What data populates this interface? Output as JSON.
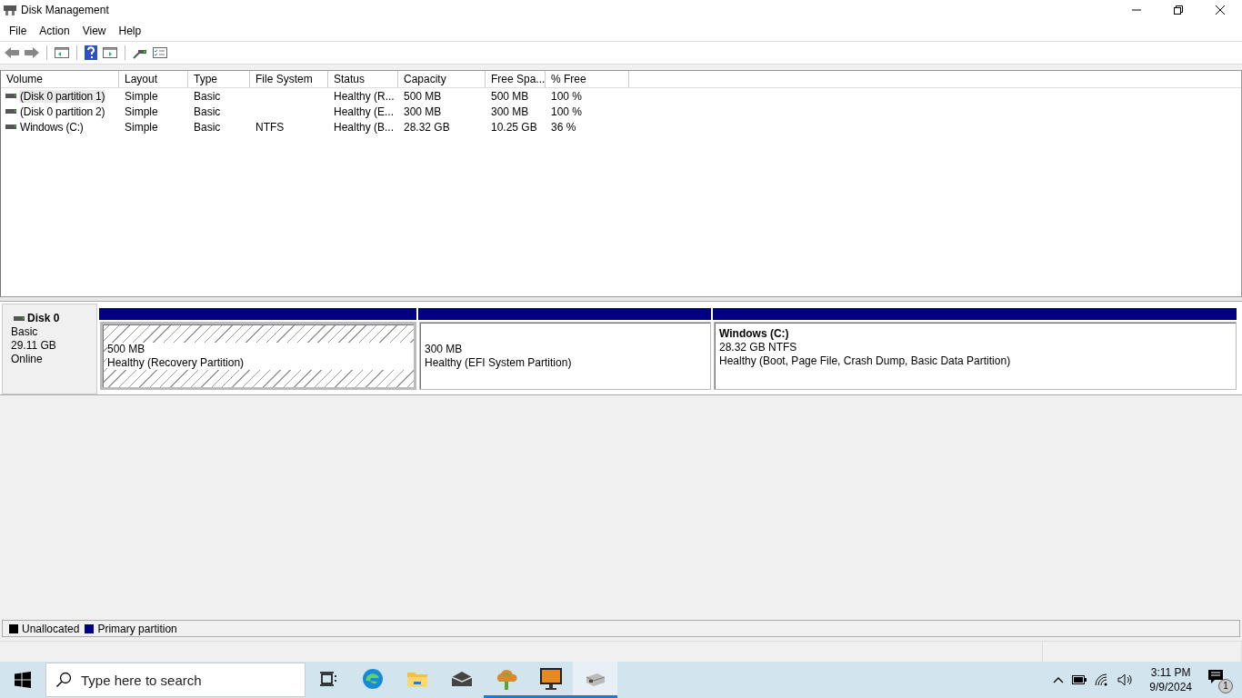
{
  "window": {
    "title": "Disk Management"
  },
  "menu": [
    "File",
    "Action",
    "View",
    "Help"
  ],
  "table": {
    "columns": [
      "Volume",
      "Layout",
      "Type",
      "File System",
      "Status",
      "Capacity",
      "Free Spa...",
      "% Free"
    ],
    "rows": [
      {
        "selected": true,
        "cells": [
          "(Disk 0 partition 1)",
          "Simple",
          "Basic",
          "",
          "Healthy (R...",
          "500 MB",
          "500 MB",
          "100 %"
        ]
      },
      {
        "selected": false,
        "cells": [
          "(Disk 0 partition 2)",
          "Simple",
          "Basic",
          "",
          "Healthy (E...",
          "300 MB",
          "300 MB",
          "100 %"
        ]
      },
      {
        "selected": false,
        "cells": [
          "Windows (C:)",
          "Simple",
          "Basic",
          "NTFS",
          "Healthy (B...",
          "28.32 GB",
          "10.25 GB",
          "36 %"
        ]
      }
    ]
  },
  "disk": {
    "name": "Disk 0",
    "type": "Basic",
    "size": "29.11 GB",
    "status": "Online",
    "partitions": [
      {
        "selected": true,
        "size": "500 MB",
        "status": "Healthy (Recovery Partition)"
      },
      {
        "selected": false,
        "size": "300 MB",
        "status": "Healthy (EFI System Partition)"
      },
      {
        "selected": false,
        "title": "Windows  (C:)",
        "size": "28.32 GB NTFS",
        "status": "Healthy (Boot, Page File, Crash Dump, Basic Data Partition)"
      }
    ]
  },
  "legend": [
    {
      "label": "Unallocated",
      "color": "#000000"
    },
    {
      "label": "Primary partition",
      "color": "#000080"
    }
  ],
  "taskbar": {
    "search": {
      "placeholder": "Type here to search"
    },
    "apps": [
      {
        "running": false,
        "selected": false
      },
      {
        "running": false,
        "selected": false
      },
      {
        "running": false,
        "selected": false
      },
      {
        "running": false,
        "selected": false
      },
      {
        "running": true,
        "selected": false
      },
      {
        "running": true,
        "selected": false
      },
      {
        "running": true,
        "selected": true
      }
    ],
    "time": "3:11 PM",
    "date": "9/9/2024",
    "notifications": "1"
  }
}
